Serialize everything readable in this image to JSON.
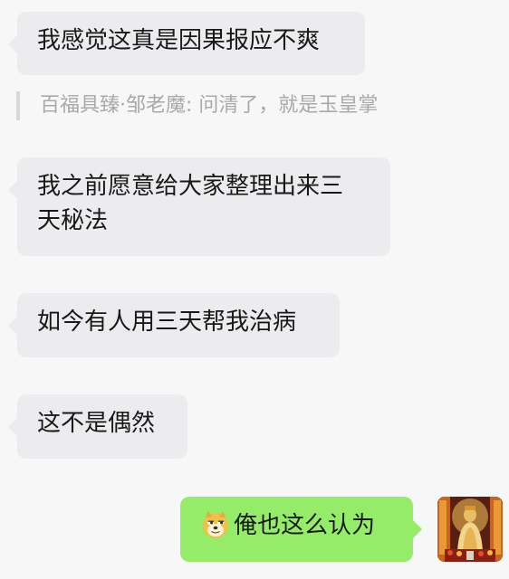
{
  "messages": [
    {
      "direction": "incoming",
      "text": "我感觉这真是因果报应不爽"
    },
    {
      "quote": "百福具臻·邹老魔: 问清了，就是玉皇掌"
    },
    {
      "direction": "incoming",
      "text_line1": "我之前愿意给大家整理出来三",
      "text_line2": "天秘法"
    },
    {
      "direction": "incoming",
      "text": "如今有人用三天帮我治病"
    },
    {
      "direction": "incoming",
      "text": "这不是偶然"
    },
    {
      "direction": "outgoing",
      "text": "俺也这么认为",
      "emoji": "doge-face-emoji"
    }
  ],
  "self_avatar": {
    "icon": "golden-deity-statue-avatar"
  },
  "colors": {
    "background": "#f7f7f7",
    "incoming_bubble": "#ececee",
    "outgoing_bubble": "#95ec69",
    "quote_text": "#a9a9a9"
  }
}
